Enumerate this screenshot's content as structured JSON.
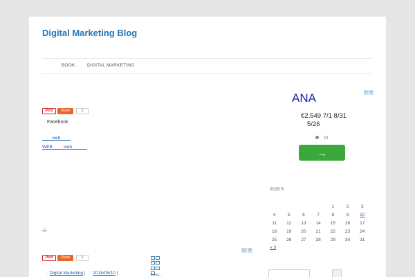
{
  "site": {
    "title": "Digital Marketing Blog"
  },
  "nav": {
    "items": [
      "BOOK",
      "DIGITAL MARKETING"
    ]
  },
  "share": {
    "pinit": "Pinit",
    "share": "Share",
    "count": "1"
  },
  "post1": {
    "facebook": "Facebook",
    "link1": "        web        ",
    "link2": "WEB         web            ",
    "more": "→"
  },
  "ad": {
    "adchoices": [
      "▷",
      "✕"
    ],
    "title": "ANA",
    "line1": "€2,549   7/1 8/31",
    "line2": "5/26",
    "button_icon": "→",
    "dots": 2,
    "active_dot": 0
  },
  "calendar": {
    "caption": "2015 5",
    "weeks": [
      [
        "",
        "",
        "",
        "",
        "1",
        "2",
        "3"
      ],
      [
        "4",
        "5",
        "6",
        "7",
        "8",
        "9",
        "10"
      ],
      [
        "11",
        "12",
        "13",
        "14",
        "15",
        "16",
        "17"
      ],
      [
        "18",
        "19",
        "20",
        "21",
        "22",
        "23",
        "24"
      ],
      [
        "25",
        "26",
        "27",
        "28",
        "29",
        "30",
        "31"
      ]
    ],
    "link_days": [
      "10"
    ],
    "prev": "« 3"
  },
  "post2": {
    "category_prefix": ": ",
    "category": "Digital Marketing",
    "separator": " |    : ",
    "date": "2015/05/10",
    "date_suffix": " |",
    "grid_caption": "books..."
  }
}
